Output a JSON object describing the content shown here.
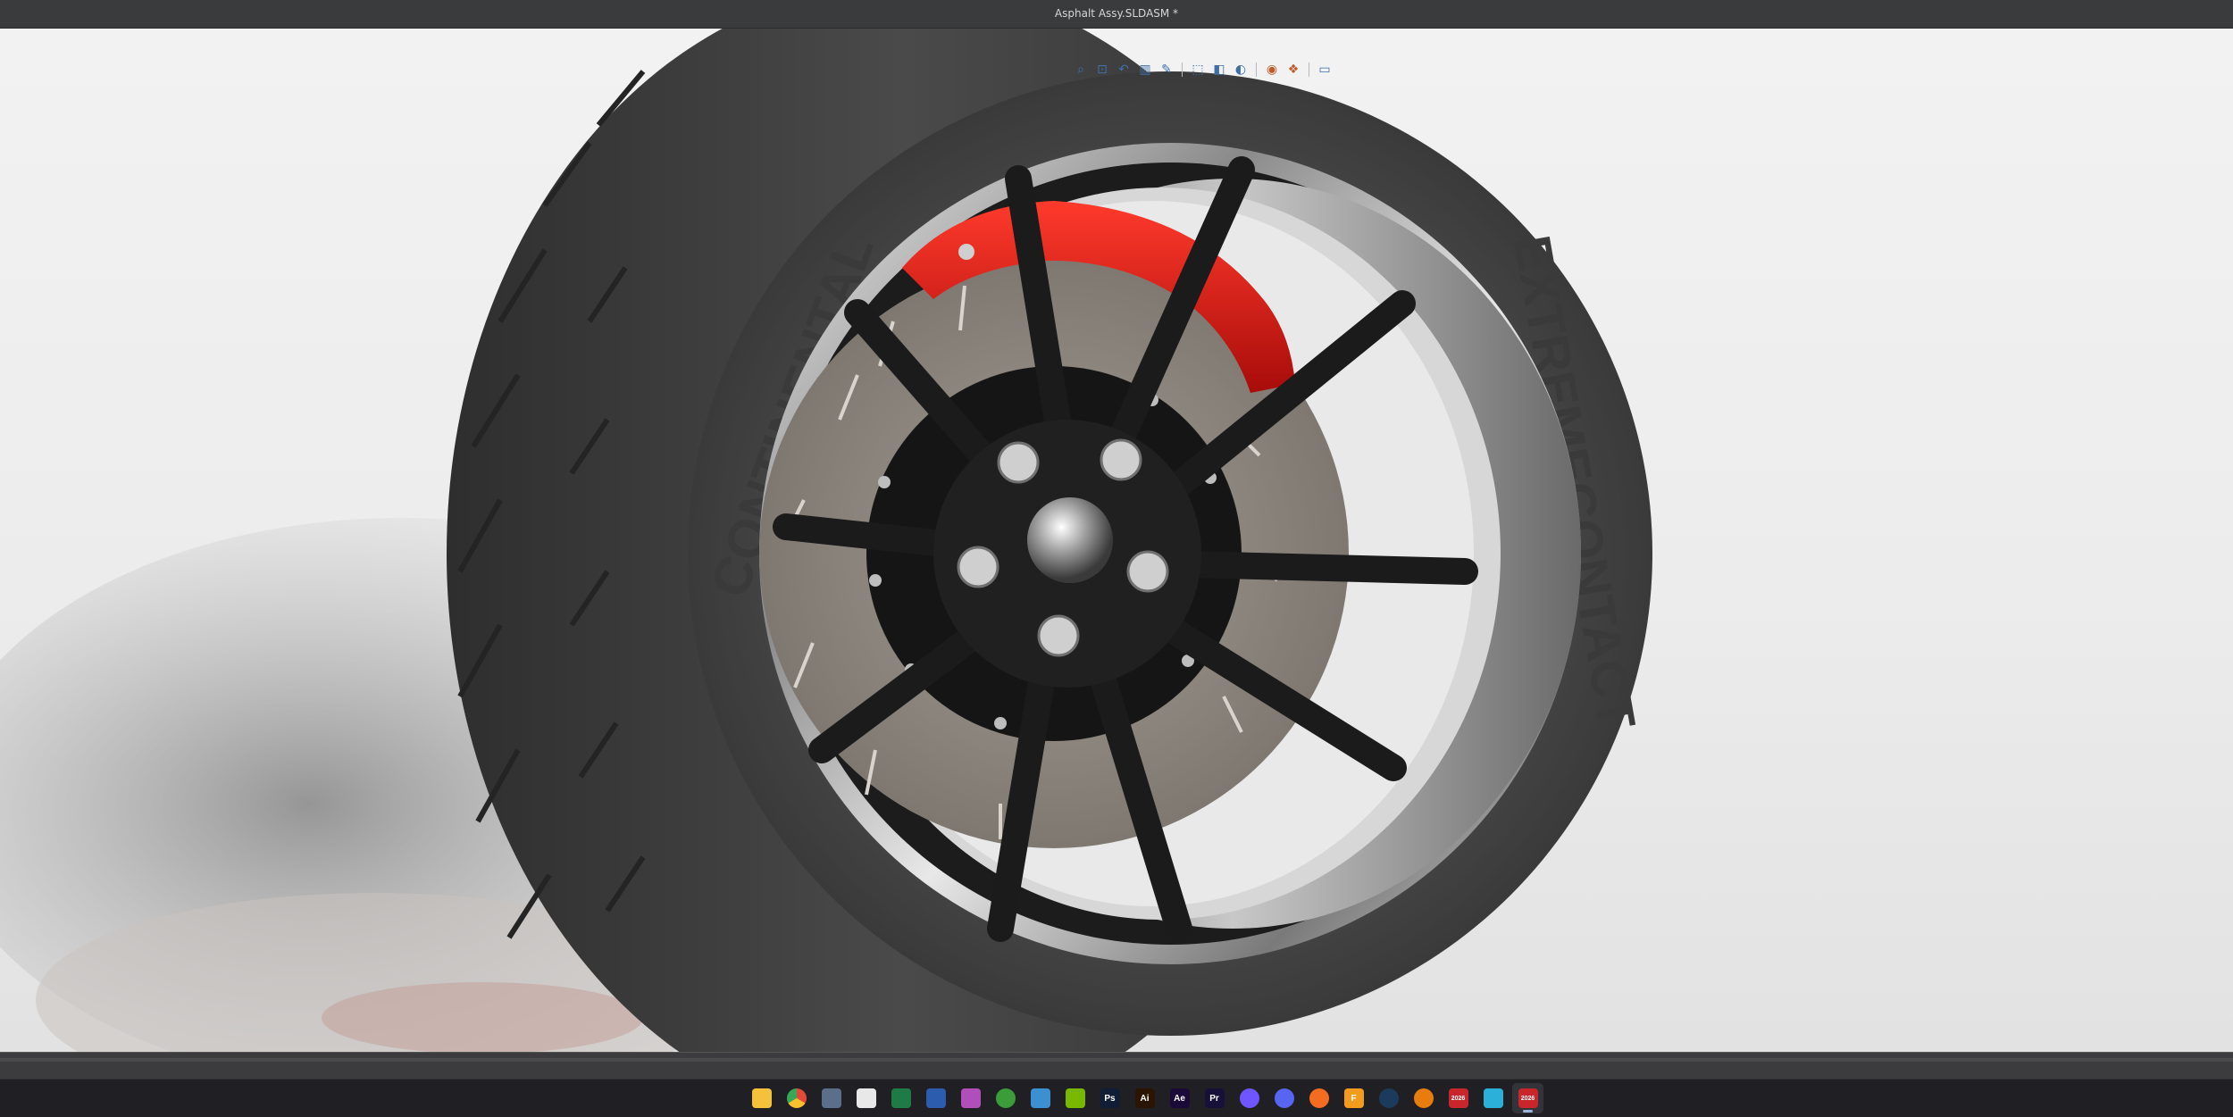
{
  "window": {
    "title": "Asphalt Assy.SLDASM *"
  },
  "viewport": {
    "model_name": "wheel-assembly",
    "tire": {
      "brand_text": "CONTINENTAL",
      "model_text": "EXTREMECONTACT"
    },
    "colors": {
      "caliper": "#d8120f",
      "tire": "#3d3d3d",
      "spokes": "#1b1b1c",
      "rim_chrome": "#cfcfcf",
      "rotor": "#8a857f",
      "background": "#efefef"
    }
  },
  "heads_up_toolbar": {
    "items": [
      {
        "name": "zoom-to-fit-icon"
      },
      {
        "name": "zoom-to-area-icon"
      },
      {
        "name": "previous-view-icon"
      },
      {
        "name": "section-view-icon"
      },
      {
        "name": "dynamic-annotation-icon"
      },
      {
        "name": "view-orientation-icon"
      },
      {
        "name": "display-style-icon"
      },
      {
        "name": "hide-show-items-icon"
      },
      {
        "name": "edit-appearance-icon"
      },
      {
        "name": "apply-scene-icon"
      },
      {
        "name": "view-settings-icon"
      }
    ]
  },
  "taskbar": {
    "icons": [
      {
        "name": "windows-start-icon",
        "color": "#3fa3ff",
        "label": ""
      },
      {
        "name": "file-explorer-icon",
        "color": "#f3c13a",
        "label": ""
      },
      {
        "name": "chrome-icon",
        "color": "#e14a3b",
        "label": ""
      },
      {
        "name": "calculator-icon",
        "color": "#5b6e8a",
        "label": ""
      },
      {
        "name": "calendar-icon",
        "color": "#e8e8e8",
        "label": ""
      },
      {
        "name": "excel-icon",
        "color": "#1e7b45",
        "label": ""
      },
      {
        "name": "word-icon",
        "color": "#2b5cad",
        "label": ""
      },
      {
        "name": "photos-icon",
        "color": "#b04fb9",
        "label": ""
      },
      {
        "name": "xbox-icon",
        "color": "#3a9d3a",
        "label": ""
      },
      {
        "name": "notepad-icon",
        "color": "#3c8fd1",
        "label": ""
      },
      {
        "name": "nvidia-icon",
        "color": "#76b900",
        "label": ""
      },
      {
        "name": "photoshop-icon",
        "color": "#0f1e36",
        "label": "Ps"
      },
      {
        "name": "illustrator-icon",
        "color": "#2b1500",
        "label": "Ai"
      },
      {
        "name": "after-effects-icon",
        "color": "#1a0a3a",
        "label": "Ae"
      },
      {
        "name": "premiere-icon",
        "color": "#16103a",
        "label": "Pr"
      },
      {
        "name": "messenger-icon",
        "color": "#6e55ff",
        "label": ""
      },
      {
        "name": "discord-icon",
        "color": "#5865f2",
        "label": ""
      },
      {
        "name": "origin-icon",
        "color": "#f36c21",
        "label": ""
      },
      {
        "name": "fusion-icon",
        "color": "#f29b1d",
        "label": "F"
      },
      {
        "name": "steam-icon",
        "color": "#1b3a5c",
        "label": ""
      },
      {
        "name": "blender-icon",
        "color": "#e87d0d",
        "label": ""
      },
      {
        "name": "solidworks-2026-icon",
        "color": "#c8262a",
        "label": "2026"
      },
      {
        "name": "box-3d-icon",
        "color": "#2ab0d9",
        "label": ""
      },
      {
        "name": "solidworks-2026-active-icon",
        "color": "#c8262a",
        "label": "2026",
        "active": true
      }
    ]
  }
}
